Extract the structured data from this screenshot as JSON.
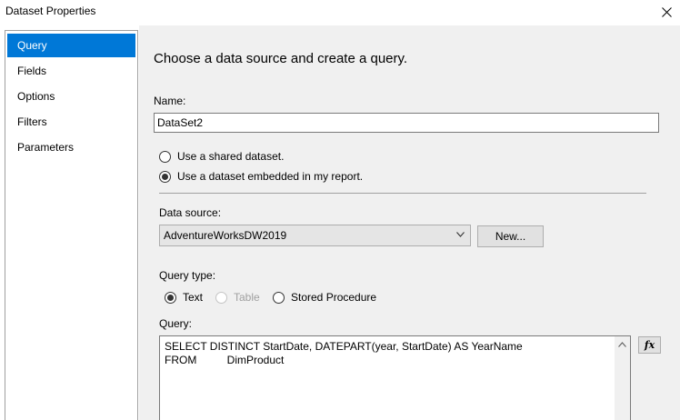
{
  "window": {
    "title": "Dataset Properties"
  },
  "sidebar": {
    "items": [
      {
        "label": "Query",
        "selected": true
      },
      {
        "label": "Fields",
        "selected": false
      },
      {
        "label": "Options",
        "selected": false
      },
      {
        "label": "Filters",
        "selected": false
      },
      {
        "label": "Parameters",
        "selected": false
      }
    ]
  },
  "main": {
    "heading": "Choose a data source and create a query.",
    "name": {
      "label": "Name:",
      "value": "DataSet2"
    },
    "dataset_mode": {
      "options": [
        {
          "label": "Use a shared dataset.",
          "checked": false
        },
        {
          "label": "Use a dataset embedded in my report.",
          "checked": true
        }
      ]
    },
    "data_source": {
      "label": "Data source:",
      "selected": "AdventureWorksDW2019",
      "new_button": "New..."
    },
    "query_type": {
      "label": "Query type:",
      "options": [
        {
          "label": "Text",
          "checked": true,
          "disabled": false
        },
        {
          "label": "Table",
          "checked": false,
          "disabled": true
        },
        {
          "label": "Stored Procedure",
          "checked": false,
          "disabled": false
        }
      ]
    },
    "query": {
      "label": "Query:",
      "lines": [
        "SELECT DISTINCT StartDate, DATEPART(year, StartDate) AS YearName",
        "FROM          DimProduct"
      ],
      "expression_button": "fx"
    }
  },
  "colors": {
    "selection": "#0078d7",
    "panel": "#f0f0f0",
    "border": "#a0a0a0"
  }
}
